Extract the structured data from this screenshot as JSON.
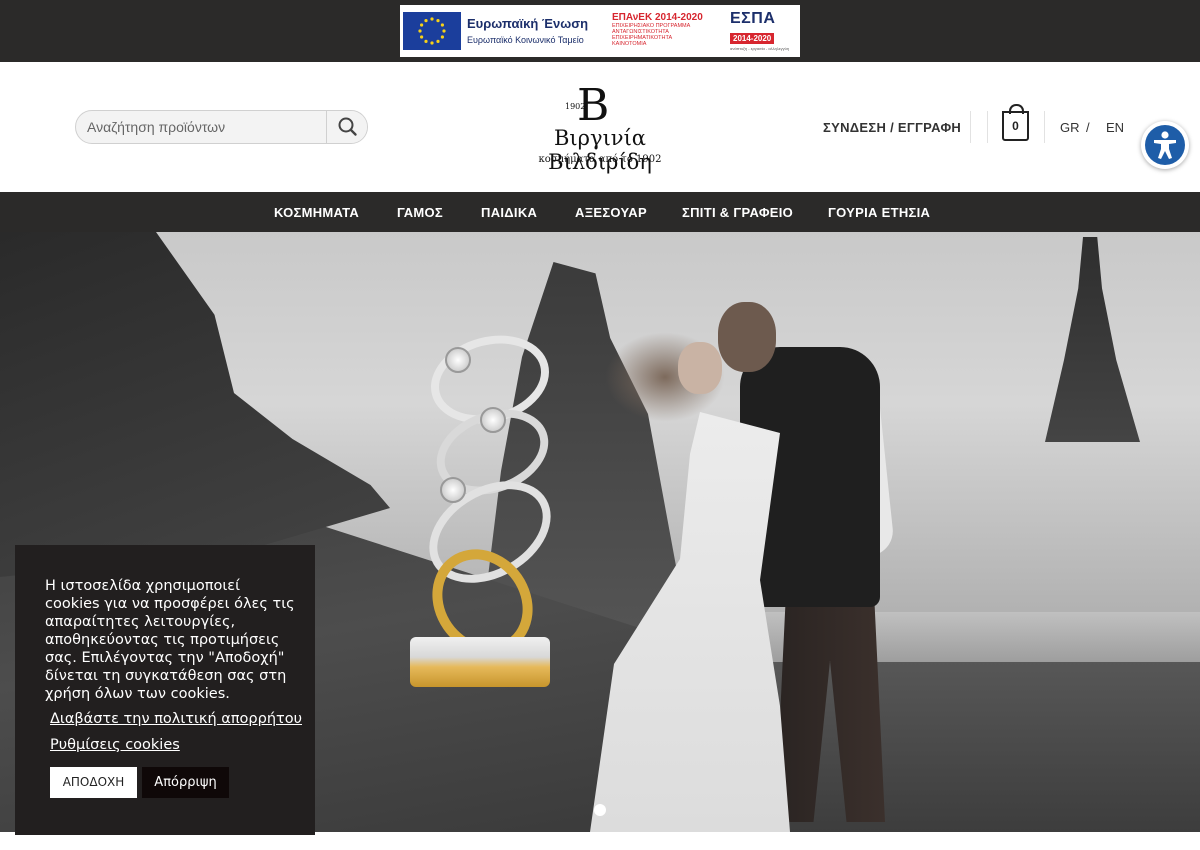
{
  "eu_banner": {
    "eu_title": "Ευρωπαϊκή Ένωση",
    "eu_subtitle": "Ευρωπαϊκό Κοινωνικό Ταμείο",
    "epanek_title": "ΕΠΑνΕΚ 2014-2020",
    "epanek_line1": "ΕΠΙΧΕΙΡΗΣΙΑΚΟ ΠΡΟΓΡΑΜΜΑ",
    "epanek_line2": "ΑΝΤΑΓΩΝΙΣΤΙΚΟΤΗΤΑ",
    "epanek_line3": "ΕΠΙΧΕΙΡΗΜΑΤΙΚΟΤΗΤΑ",
    "epanek_line4": "ΚΑΙΝΟΤΟΜΙΑ",
    "espa_title": "ΕΣΠΑ",
    "espa_years": "2014-2020",
    "espa_sub": "ανάπτυξη - εργασία - αλληλεγγύη"
  },
  "search": {
    "placeholder": "Αναζήτηση προϊόντων"
  },
  "logo": {
    "letter": "B",
    "year": "1902",
    "name": "Βιργινία Βιλδιρίδη",
    "tagline": "κοσμήματα από το 1902"
  },
  "header": {
    "login_label": "ΣΥΝΔΕΣΗ / ΕΓΓΡΑΦΗ",
    "cart_count": "0",
    "lang_gr": "GR",
    "lang_sep": "/",
    "lang_en": "EN"
  },
  "nav": {
    "items": [
      {
        "label": "ΚΟΣΜΗΜΑΤΑ"
      },
      {
        "label": "ΓΑΜΟΣ"
      },
      {
        "label": "ΠΑΙΔΙΚΑ"
      },
      {
        "label": "ΑΞΕΣΟΥΑΡ"
      },
      {
        "label": "ΣΠΙΤΙ & ΓΡΑΦΕΙΟ"
      },
      {
        "label": "ΓΟΥΡΙΑ ΕΤΗΣΙΑ"
      }
    ]
  },
  "cookie": {
    "text": "Η ιστοσελίδα χρησιμοποιεί cookies για να προσφέρει όλες τις απαραίτητες λειτουργίες, αποθηκεύοντας τις προτιμήσεις σας. Επιλέγοντας την \"Αποδοχή\" δίνεται τη συγκατάθεση σας στη χρήση όλων των cookies.",
    "privacy_link": "Διαβάστε την πολιτική απορρήτου",
    "settings_link": "Ρυθμίσεις cookies",
    "accept_label": "ΑΠΟΔΟΧΗ",
    "reject_label": "Απόρριψη"
  },
  "colors": {
    "dark_bar": "#2b2a29",
    "cookie_bg": "#221f1f",
    "accessibility_blue": "#1e5da8"
  },
  "icons": {
    "search": "magnifier-icon",
    "cart": "shopping-bag-icon",
    "accessibility": "accessibility-person-icon"
  }
}
